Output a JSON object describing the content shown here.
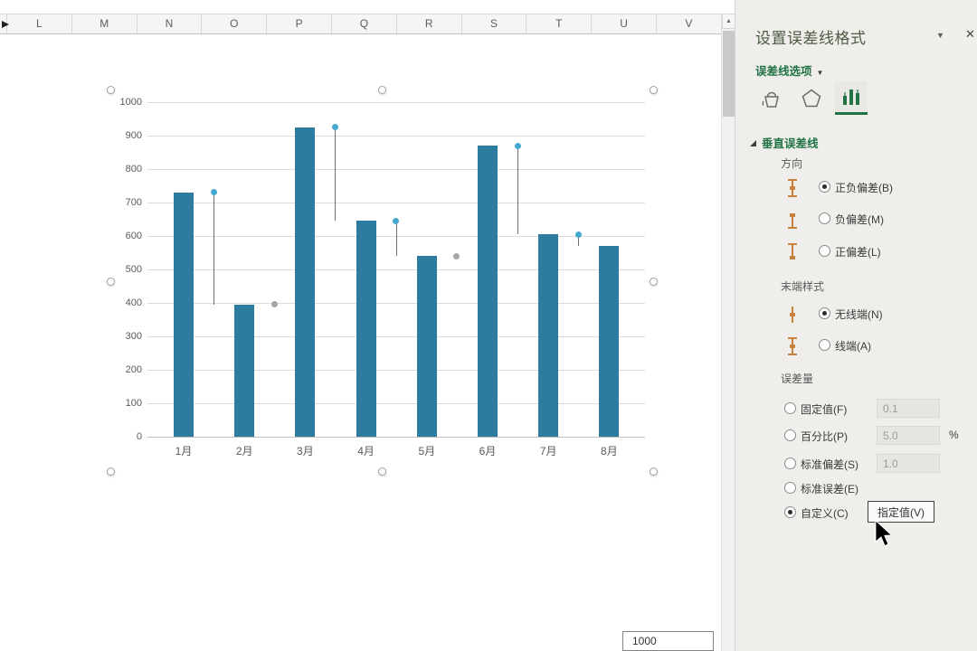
{
  "spreadsheet": {
    "columns": [
      "L",
      "M",
      "N",
      "O",
      "P",
      "Q",
      "R",
      "S",
      "T",
      "U",
      "V"
    ],
    "floating_cell_value": "1000"
  },
  "scrollbar": {
    "up_arrow": "▲"
  },
  "chart_data": {
    "type": "bar",
    "title": "",
    "categories": [
      "1月",
      "2月",
      "3月",
      "4月",
      "5月",
      "6月",
      "7月",
      "8月"
    ],
    "series": [
      {
        "name": "column-series",
        "type": "column",
        "color": "#2D7B9E",
        "values": [
          730,
          395,
          925,
          645,
          540,
          870,
          605,
          570
        ]
      }
    ],
    "scatter_points": [
      {
        "category_index": 0,
        "y": 730,
        "color": "#44A8D0",
        "error_low": 395
      },
      {
        "category_index": 1,
        "y": 395,
        "color": "#A6A6A6"
      },
      {
        "category_index": 2,
        "y": 925,
        "color": "#44A8D0",
        "error_low": 645
      },
      {
        "category_index": 3,
        "y": 645,
        "color": "#44A8D0",
        "error_low": 540
      },
      {
        "category_index": 4,
        "y": 540,
        "color": "#A6A6A6"
      },
      {
        "category_index": 5,
        "y": 870,
        "color": "#44A8D0",
        "error_low": 605
      },
      {
        "category_index": 6,
        "y": 605,
        "color": "#44A8D0",
        "error_low": 570
      }
    ],
    "ylim": [
      0,
      1000
    ],
    "ytick_step": 100,
    "grid": true,
    "legend": "none",
    "error_line_color": "#6E6E6E",
    "gridline_color": "#DCDCDC"
  },
  "panel": {
    "title": "设置误差线格式",
    "title_caret": "▼",
    "close_glyph": "✕",
    "options_label": "误差线选项",
    "options_caret": "▼",
    "tabs": [
      {
        "name": "fill-line",
        "selected": false
      },
      {
        "name": "effects",
        "selected": false
      },
      {
        "name": "error-bar-options",
        "selected": true
      }
    ],
    "vertical_label": "垂直误差线",
    "direction": {
      "label": "方向",
      "options": [
        {
          "label": "正负偏差(B)",
          "selected": true
        },
        {
          "label": "负偏差(M)",
          "selected": false
        },
        {
          "label": "正偏差(L)",
          "selected": false
        }
      ]
    },
    "end_style": {
      "label": "末端样式",
      "options": [
        {
          "label": "无线端(N)",
          "selected": true
        },
        {
          "label": "线端(A)",
          "selected": false
        }
      ]
    },
    "amount": {
      "label": "误差量",
      "percent_suffix": "%",
      "options": [
        {
          "label": "固定值(F)",
          "selected": false,
          "value": "0.1"
        },
        {
          "label": "百分比(P)",
          "selected": false,
          "value": "5.0"
        },
        {
          "label": "标准偏差(S)",
          "selected": false,
          "value": "1.0"
        },
        {
          "label": "标准误差(E)",
          "selected": false
        },
        {
          "label": "自定义(C)",
          "selected": true,
          "button": "指定值(V)"
        }
      ]
    },
    "accent_green": "#217346"
  }
}
